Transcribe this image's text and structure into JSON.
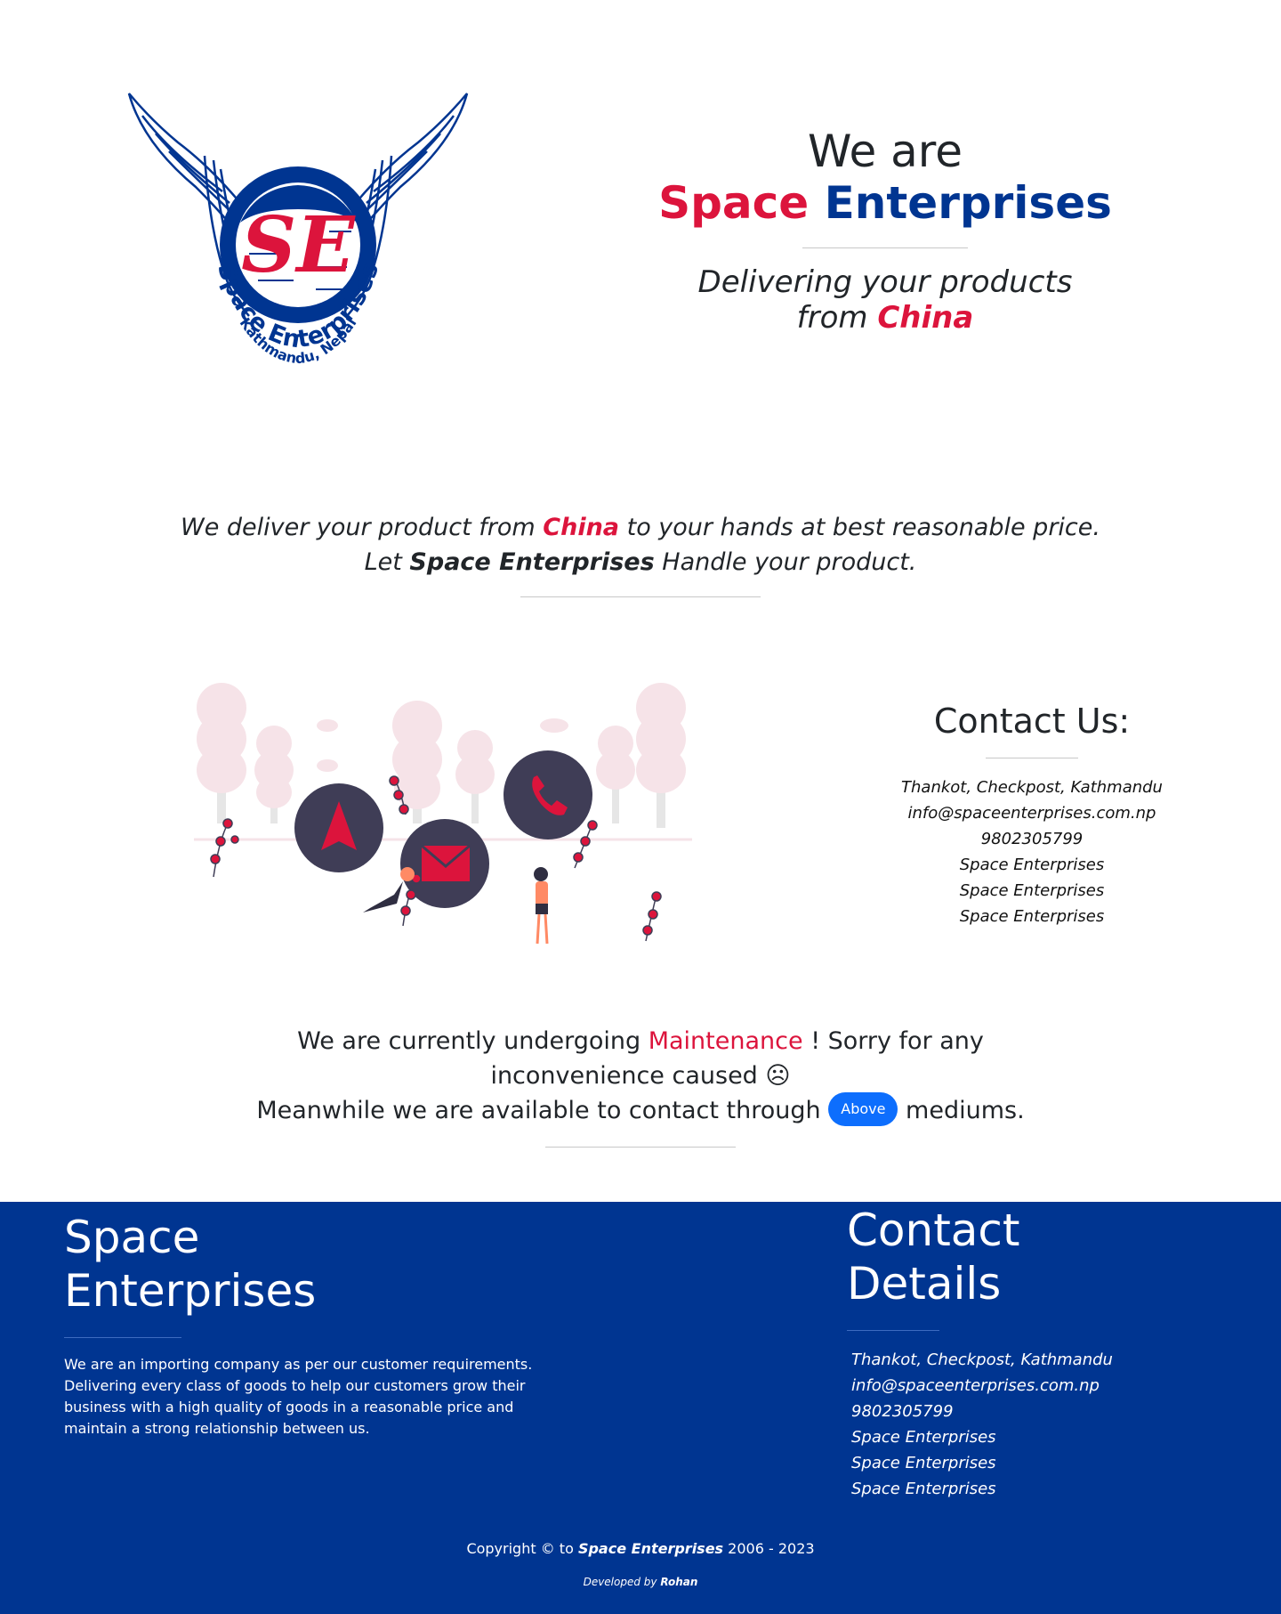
{
  "hero": {
    "we_are": "We are",
    "name_first": "Space",
    "name_second": "Enterprises",
    "subtitle_line1": "Delivering your products",
    "subtitle_from": "from",
    "subtitle_country": "China"
  },
  "logo": {
    "ring_text": "Space Enterprises",
    "place_text": "Kathmandu, Nepal",
    "monogram": "SE"
  },
  "tagline": {
    "part1": "We deliver your product from",
    "country": "China",
    "part2": "to your hands at best reasonable price.",
    "let": "Let",
    "company": "Space Enterprises",
    "part3": "Handle your product."
  },
  "contact": {
    "title": "Contact Us:",
    "items": [
      "Thankot, Checkpost, Kathmandu",
      "info@spaceenterprises.com.np",
      "9802305799",
      "Space Enterprises",
      "Space Enterprises",
      "Space Enterprises"
    ]
  },
  "maintenance": {
    "part1": "We are currently undergoing",
    "word": "Maintenance",
    "part2": "! Sorry for any",
    "line2": "inconvenience caused ☹",
    "part3": "Meanwhile we are available to contact through",
    "badge": "Above",
    "part4": "mediums."
  },
  "footer": {
    "title_line1": "Space",
    "title_line2": "Enterprises",
    "about": "We are an importing company as per our customer requirements. Delivering every class of goods to help our customers grow their business with a high quality of goods in a reasonable price and maintain a strong relationship between us.",
    "contact_title_line1": "Contact",
    "contact_title_line2": "Details",
    "contact_items": [
      "Thankot, Checkpost, Kathmandu",
      "info@spaceenterprises.com.np",
      "9802305799",
      "Space Enterprises",
      "Space Enterprises",
      "Space Enterprises"
    ],
    "copyright_prefix": "Copyright © to",
    "copyright_company": "Space Enterprises",
    "copyright_years": "2006 - 2023",
    "developed_by": "Developed by",
    "developer": "Rohan"
  },
  "colors": {
    "brand_red": "#dc143c",
    "brand_blue": "#003591",
    "badge_blue": "#0d6efd",
    "footer_bg": "#003591"
  }
}
